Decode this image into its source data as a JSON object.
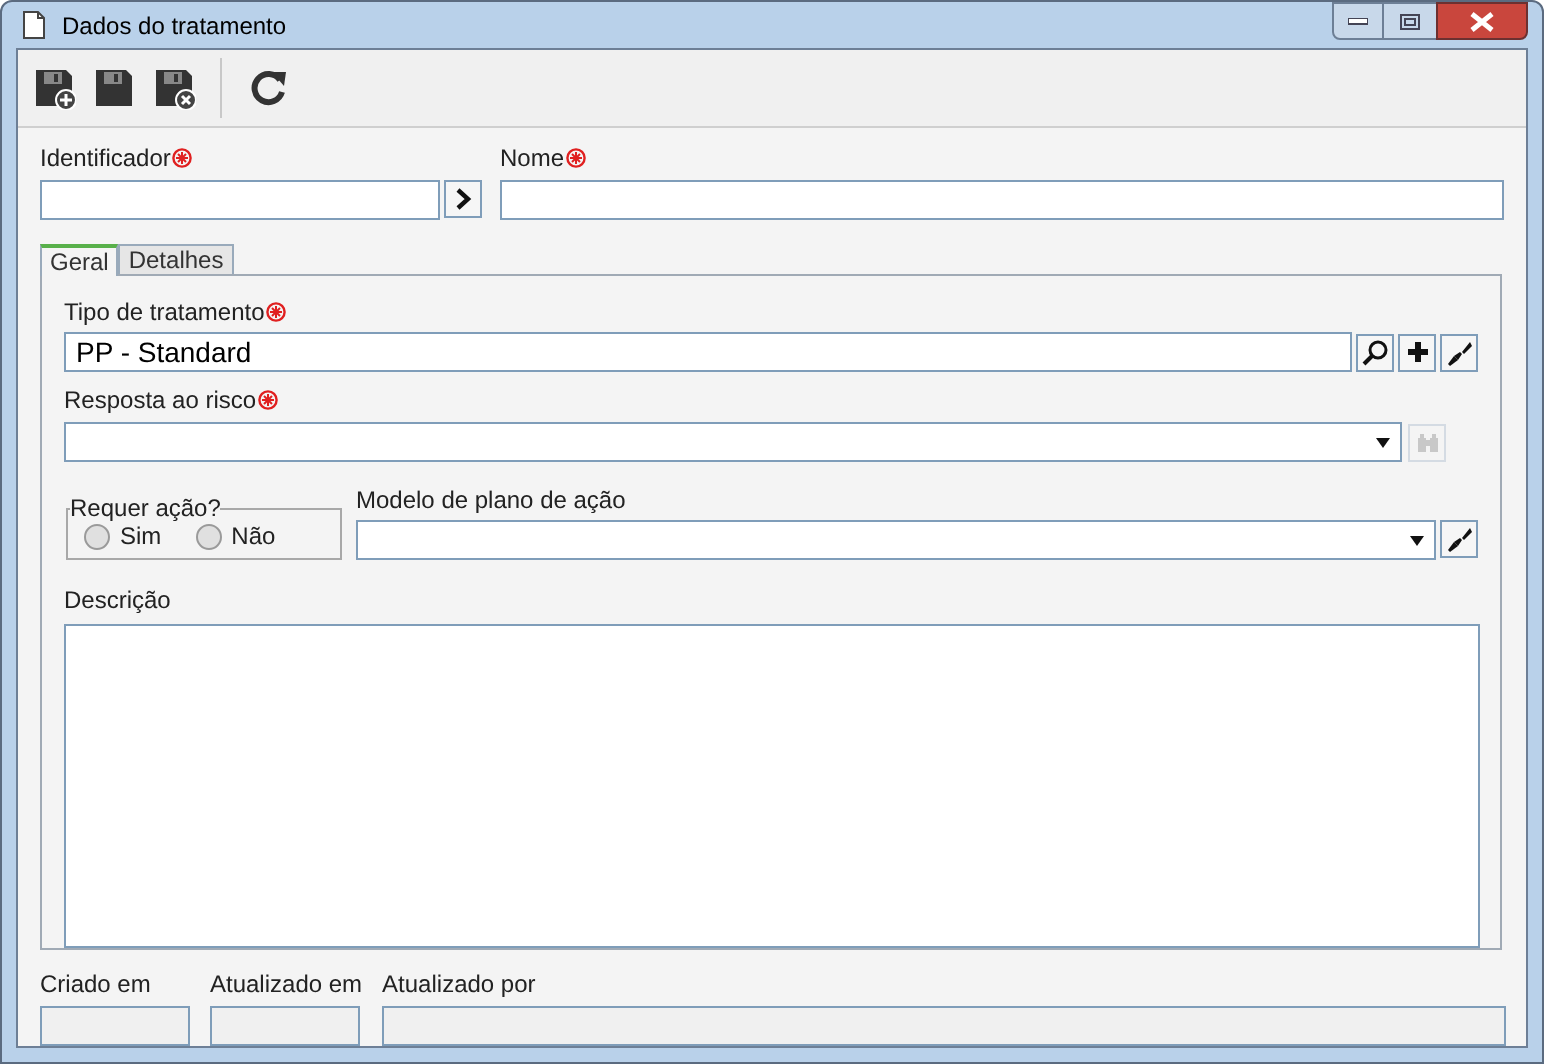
{
  "window": {
    "title": "Dados do tratamento"
  },
  "identificador": {
    "label": "Identificador",
    "required": true
  },
  "nome": {
    "label": "Nome",
    "required": true
  },
  "tabs": [
    {
      "label": "Geral",
      "selected": true
    },
    {
      "label": "Detalhes",
      "selected": false
    }
  ],
  "tipo": {
    "label": "Tipo de tratamento",
    "required": true,
    "value": "PP - Standard"
  },
  "resposta": {
    "label": "Resposta ao risco",
    "required": true,
    "search_disabled": true
  },
  "requer_acao": {
    "legend": "Requer ação?",
    "options": [
      {
        "label": "Sim",
        "selected": false
      },
      {
        "label": "Não",
        "selected": false
      }
    ]
  },
  "modelo": {
    "label": "Modelo de plano de ação"
  },
  "descricao": {
    "label": "Descrição"
  },
  "footer": [
    {
      "label": "Criado em"
    },
    {
      "label": "Atualizado em"
    },
    {
      "label": "Atualizado por"
    }
  ]
}
